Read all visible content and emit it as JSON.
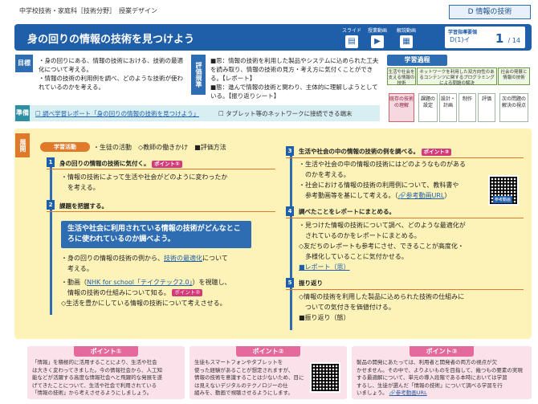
{
  "header": {
    "subtitle": "中学校技術・家庭科［技術分野］　授業デザイン",
    "subject_tag": "D 情報の技術",
    "title": "身の回りの情報の技術を見つけよう",
    "icons": [
      {
        "label": "スライド",
        "icon": "slide-icon",
        "glyph": "▤"
      },
      {
        "label": "授業動画",
        "icon": "video-icon",
        "glyph": "▶"
      },
      {
        "label": "解説動画",
        "icon": "film-icon",
        "glyph": "▦"
      }
    ],
    "guide_label": "学習指導要領",
    "guide_qr": "D(1)イ",
    "page_current": "1",
    "page_total": "/ 14"
  },
  "goal": {
    "label": "目標",
    "lines": [
      "・身の回りにある、情報の技術における、技術の最適化について考える。",
      "・情報の技術の利用例を調べ、どのような技術が使われているのかを考える。"
    ]
  },
  "evaluation": {
    "label": "評価規準",
    "lines": [
      "■思：情報の技術を利用した製品やシステムに込められた工夫を読み取り、情報の技術の見方・考え方に気付くことができる。【レポート】",
      "■態：進んで情報の技術と関わり、主体的に理解しようとしている。【振り返りシート】"
    ]
  },
  "process": {
    "title": "学習過程",
    "col1": "生活や社会を支える情報の技術",
    "col2": "ネットワークを利用した双方向性のあるコンテンツに関するプログラミングによる問題の解決",
    "col3": "社会の発展と情報の技術",
    "cells": [
      "既存の技術の理解",
      "課題の設定",
      "設計・計画",
      "制作",
      "評価",
      "次の問題の解決の視点"
    ]
  },
  "prep": {
    "label": "準備",
    "item1": "☐ 調べ学習レポート「身の回りの情報の技術を見つけよう」",
    "item2": "☐ タブレット等のネットワークに接続できる端末"
  },
  "development": {
    "label": "展開",
    "activity_tag": "学習活動",
    "legend": "・生徒の活動　◇教師の働きかけ　■評価方法",
    "steps": [
      {
        "num": "1",
        "title": "身の回りの情報の技術に気付く。",
        "point": "ポイント①"
      },
      {
        "num": "2",
        "title": "課題を把握する。"
      },
      {
        "num": "3",
        "title": "生活や社会の中の情報の技術の例を調べる。",
        "point": "ポイント③"
      },
      {
        "num": "4",
        "title": "調べたことをレポートにまとめる。"
      },
      {
        "num": "5",
        "title": "振り返り"
      }
    ],
    "s1_line1": "・情報の技術によって生活や社会がどのように変わったか",
    "s1_line2": "　を考える。",
    "callout": "生活や社会に利用されている情報の技術がどんなところに使われているのか調べよう。",
    "s2_line1a": "・身の回りの情報の技術の例から、",
    "s2_link": "技術の最適化",
    "s2_line1b": "について",
    "s2_line2": "　考える。",
    "s2_video_a": "・動画（",
    "s2_video_link": "NHK for school「テイクテック2.0」",
    "s2_video_b": "）を視聴し、",
    "s2_video_line2": "　情報の技術の仕組みについて知る。",
    "s2_point": "ポイント②",
    "s2_teacher": "◇生活を豊かにしている情報の技術について考えさせる。",
    "s3_line1": "・生活や社会の中の情報の技術にはどのようなものがある",
    "s3_line2": "　のかを考える。",
    "s3_line3": "・社会における情報の技術の利用例について、教科書や",
    "s3_line4a": "　参考動画等を基にして考える。（",
    "s3_link": "🔗参考動画URL",
    "s3_line4b": "）",
    "s3_qr_badge": "参考動画",
    "s4_line1": "・見つけた情報の技術について調べ、どのような最適化が",
    "s4_line2": "　されているのかをレポートにまとめる。",
    "s4_line3": "◇友だちのレポートも参考にさせ、できることが高度化・",
    "s4_line4": "　多様化していることに気付かせる。",
    "s4_eval": "■レポート（思）",
    "s5_line1": "◇情報の技術を利用した製品に込められた技術の仕組みに",
    "s5_line2": "　ついての気付きを価値付ける。",
    "s5_eval": "■振り返り（態）"
  },
  "points": [
    {
      "title": "ポイント①",
      "lines": [
        "「情報」を積極的に活用することにより、生活や社会",
        "は大きく変わってきました。今の情報社会から、人工知",
        "能などが活躍する高度な情報社会へと飛躍的な発展を遂",
        "げてきたことについて、生活や社会で利用されている",
        "「情報の技術」から考えさせるようにしましょう。"
      ]
    },
    {
      "title": "ポイント②",
      "lines": [
        "生徒もスマートフォンやタブレットを",
        "使った経験があることが想定されますが、",
        "情報の技術を意識することは少ないため、目に",
        "は見えないデジタルのテクノロジーの仕",
        "組みを、動画で視聴させるようにします。"
      ]
    },
    {
      "title": "ポイント③",
      "lines": [
        "製品の開発にあたっては、利用者と開発者の両方の視点が欠",
        "かせません。その中で、よりよいものを目指して、幾つもの要素の実現",
        "する最適解について、単元の導入段階である本時においては学習",
        "するし、生徒が選んだ「情報の技術」について調べる学習を行",
        "いましょう。"
      ],
      "link": "🔗参考動画URL"
    }
  ]
}
